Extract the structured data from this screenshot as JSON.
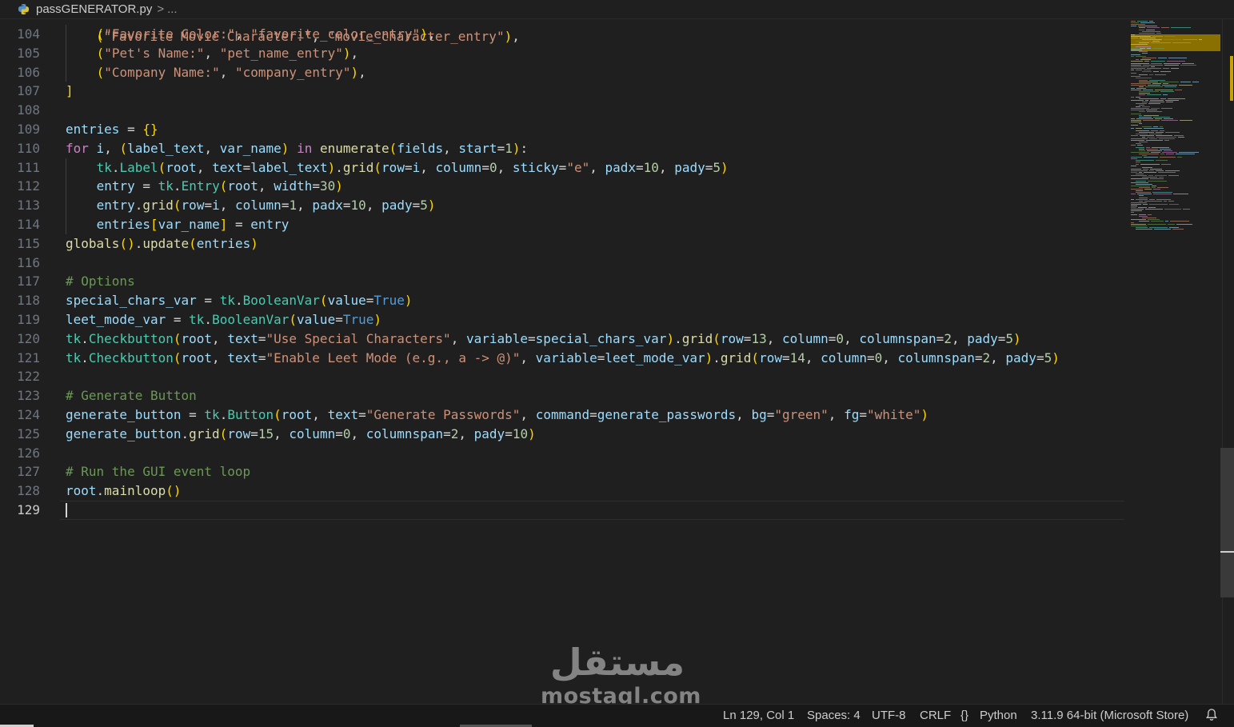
{
  "breadcrumb": {
    "file_name": "passGENERATOR.py",
    "separator": ">",
    "more": "..."
  },
  "editor": {
    "partial_line": "(\"Favorite Movie Character:\", \"movie_character_entry\"),",
    "lines": [
      {
        "n": "104",
        "text": "    (\"Favorite Color:\", \"favorite_color_entry\"),"
      },
      {
        "n": "105",
        "text": "    (\"Pet's Name:\", \"pet_name_entry\"),"
      },
      {
        "n": "106",
        "text": "    (\"Company Name:\", \"company_entry\"),"
      },
      {
        "n": "107",
        "text": "]"
      },
      {
        "n": "108",
        "text": ""
      },
      {
        "n": "109",
        "text": "entries = {}"
      },
      {
        "n": "110",
        "text": "for i, (label_text, var_name) in enumerate(fields, start=1):"
      },
      {
        "n": "111",
        "text": "    tk.Label(root, text=label_text).grid(row=i, column=0, sticky=\"e\", padx=10, pady=5)"
      },
      {
        "n": "112",
        "text": "    entry = tk.Entry(root, width=30)"
      },
      {
        "n": "113",
        "text": "    entry.grid(row=i, column=1, padx=10, pady=5)"
      },
      {
        "n": "114",
        "text": "    entries[var_name] = entry"
      },
      {
        "n": "115",
        "text": "globals().update(entries)"
      },
      {
        "n": "116",
        "text": ""
      },
      {
        "n": "117",
        "text": "# Options"
      },
      {
        "n": "118",
        "text": "special_chars_var = tk.BooleanVar(value=True)"
      },
      {
        "n": "119",
        "text": "leet_mode_var = tk.BooleanVar(value=True)"
      },
      {
        "n": "120",
        "text": "tk.Checkbutton(root, text=\"Use Special Characters\", variable=special_chars_var).grid(row=13, column=0, columnspan=2, pady=5)"
      },
      {
        "n": "121",
        "text": "tk.Checkbutton(root, text=\"Enable Leet Mode (e.g., a -> @)\", variable=leet_mode_var).grid(row=14, column=0, columnspan=2, pady=5)"
      },
      {
        "n": "122",
        "text": ""
      },
      {
        "n": "123",
        "text": "# Generate Button"
      },
      {
        "n": "124",
        "text": "generate_button = tk.Button(root, text=\"Generate Passwords\", command=generate_passwords, bg=\"green\", fg=\"white\")"
      },
      {
        "n": "125",
        "text": "generate_button.grid(row=15, column=0, columnspan=2, pady=10)"
      },
      {
        "n": "126",
        "text": ""
      },
      {
        "n": "127",
        "text": "# Run the GUI event loop"
      },
      {
        "n": "128",
        "text": "root.mainloop()"
      },
      {
        "n": "129",
        "text": ""
      }
    ]
  },
  "watermark": {
    "arabic": "مستقل",
    "latin": "mostaql.com"
  },
  "statusbar": {
    "position": "Ln 129, Col 1",
    "spaces": "Spaces: 4",
    "encoding": "UTF-8",
    "eol": "CRLF",
    "language_braces": "{}",
    "language": "Python",
    "interpreter": "3.11.9 64-bit (Microsoft Store)",
    "notification_icon": "bell-icon"
  },
  "colors": {
    "background": "#1f1f1f",
    "keyword": "#c586c0",
    "variable": "#9cdcfe",
    "string": "#ce9178",
    "number": "#b5cea8",
    "class": "#4ec9b0",
    "function": "#dcdcaa",
    "constant": "#569cd6",
    "comment": "#6a9955",
    "bracket_1": "#ffd700",
    "bracket_2": "#da70d6",
    "bracket_3": "#179fff"
  }
}
